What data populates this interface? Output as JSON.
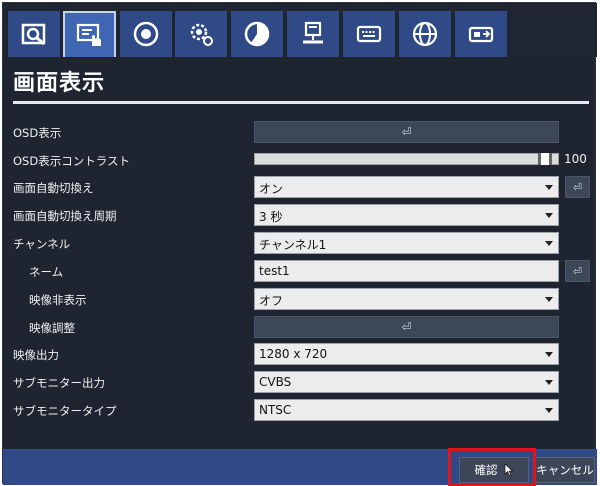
{
  "tabs": [
    {
      "icon": "camera-search-icon"
    },
    {
      "icon": "display-hand-icon",
      "active": true
    },
    {
      "icon": "record-icon"
    },
    {
      "icon": "gear-icon"
    },
    {
      "icon": "pie-chart-icon"
    },
    {
      "icon": "network-computer-icon"
    },
    {
      "icon": "keyboard-icon"
    },
    {
      "icon": "globe-icon"
    },
    {
      "icon": "camera-link-icon"
    }
  ],
  "page": {
    "title": "画面表示"
  },
  "settings": {
    "osd_display": {
      "label": "OSD表示",
      "button": "⏎"
    },
    "osd_contrast": {
      "label": "OSD表示コントラスト",
      "value": "100",
      "level": 1.0
    },
    "auto_switch": {
      "label": "画面自動切換え",
      "value": "オン",
      "side_button": "⏎"
    },
    "switch_interval": {
      "label": "画面自動切換え周期",
      "value": "3 秒"
    },
    "channel": {
      "label": "チャンネル",
      "value": "チャンネル1"
    },
    "name": {
      "label": "ネーム",
      "value": "test1",
      "side_button": "⏎"
    },
    "video_hide": {
      "label": "映像非表示",
      "value": "オフ"
    },
    "video_adjust": {
      "label": "映像調整",
      "button": "⏎"
    },
    "video_output": {
      "label": "映像出力",
      "value": "1280 x 720"
    },
    "sub_monitor_output": {
      "label": "サブモニター出力",
      "value": "CVBS"
    },
    "sub_monitor_type": {
      "label": "サブモニタータイプ",
      "value": "NTSC"
    }
  },
  "footer": {
    "ok_label": "確認",
    "cancel_label": "キャンセル"
  },
  "colors": {
    "tab_bg": "#2f4a86",
    "tab_active": "#3f66b3",
    "panel_bg": "#1e2430",
    "highlight": "#e0141c"
  }
}
